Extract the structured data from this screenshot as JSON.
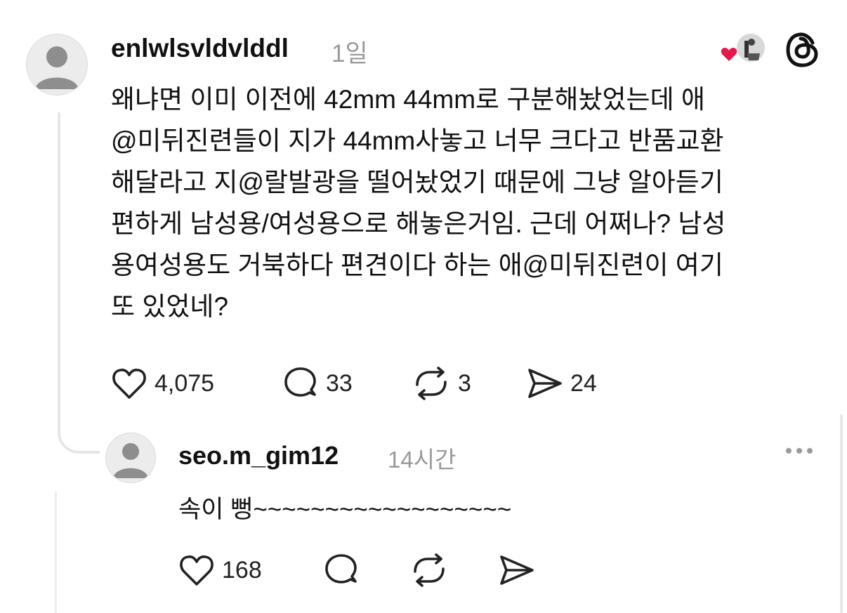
{
  "post": {
    "username": "enlwlsvldvlddl",
    "time": "1일",
    "lines": [
      "왜냐면 이미 이전에 42mm 44mm로 구분해놨었는데 애",
      "@미뒤진련들이 지가 44mm사놓고 너무 크다고 반품교환",
      "해달라고 지@랄발광을 떨어놨었기 때문에 그냥 알아듣기",
      "편하게 남성용/여성용으로 해놓은거임. 근데 어쩌나? 남성",
      "용여성용도 거북하다 편견이다 하는 애@미뒤진련이 여기",
      "또 있었네?"
    ],
    "likes": "4,075",
    "comments": "33",
    "reposts": "3",
    "shares": "24"
  },
  "reply": {
    "username": "seo.m_gim12",
    "time": "14시간",
    "text": "속이 뻥~~~~~~~~~~~~~~~~~~",
    "likes": "168"
  },
  "icons": {
    "like": "heart-icon",
    "comment": "comment-bubble-icon",
    "repost": "repost-icon",
    "share": "send-icon",
    "threads": "threads-logo-icon",
    "more": "more-dots-icon"
  },
  "colors": {
    "like_badge": "#e8174a",
    "muted": "#9a9a9a",
    "text": "#111111"
  }
}
